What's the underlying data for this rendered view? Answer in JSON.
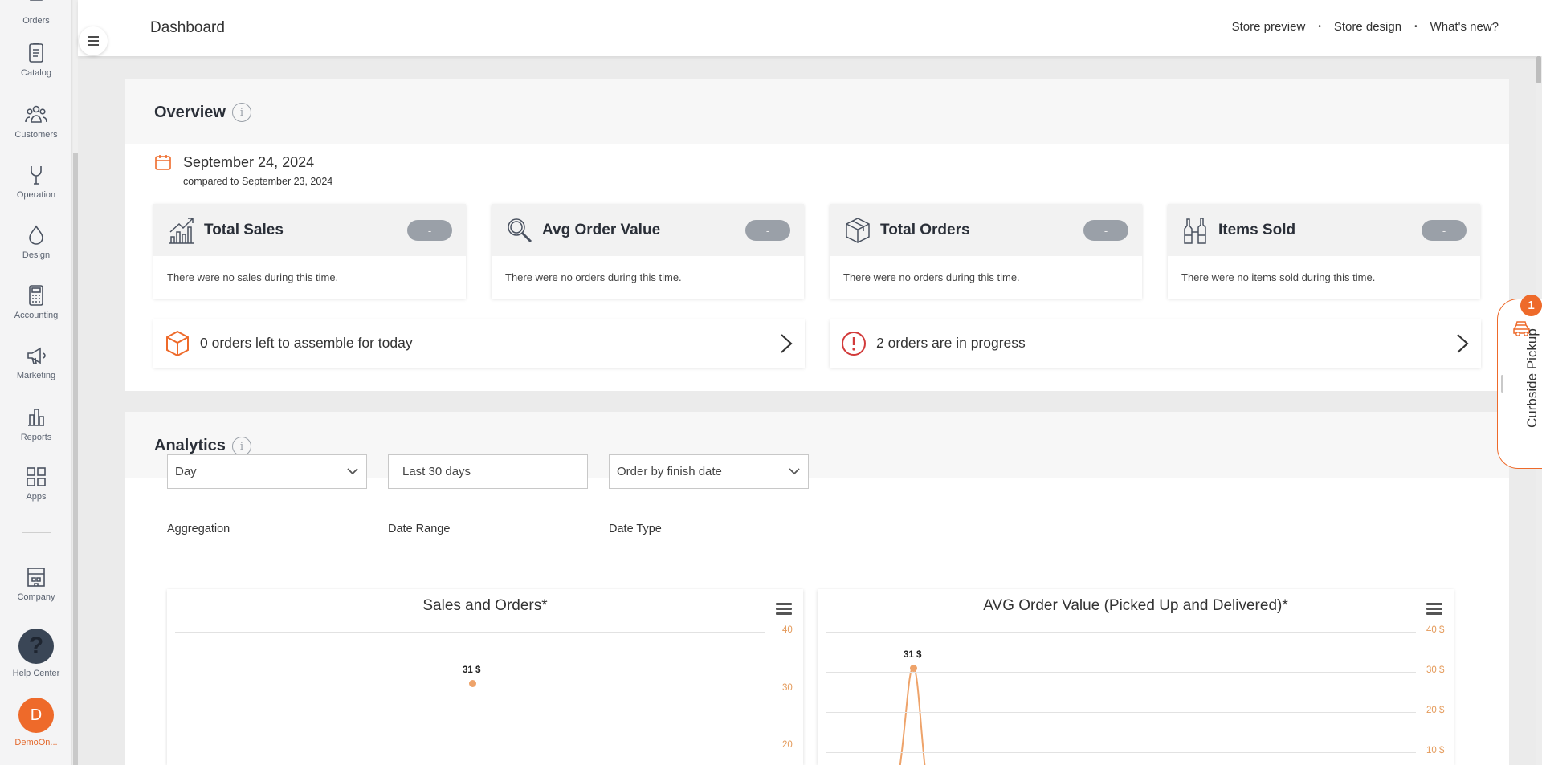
{
  "sidebar": {
    "items": [
      {
        "label": "Orders",
        "icon": "orders-icon"
      },
      {
        "label": "Catalog",
        "icon": "catalog-icon"
      },
      {
        "label": "Customers",
        "icon": "customers-icon"
      },
      {
        "label": "Operation",
        "icon": "operation-icon"
      },
      {
        "label": "Design",
        "icon": "design-icon"
      },
      {
        "label": "Accounting",
        "icon": "accounting-icon"
      },
      {
        "label": "Marketing",
        "icon": "marketing-icon"
      },
      {
        "label": "Reports",
        "icon": "reports-icon"
      },
      {
        "label": "Apps",
        "icon": "apps-icon"
      },
      {
        "label": "Company",
        "icon": "company-icon"
      },
      {
        "label": "Help Center",
        "icon": "help-icon"
      }
    ],
    "help_glyph": "?",
    "avatar_letter": "D",
    "org_name": "DemoOn..."
  },
  "header": {
    "title": "Dashboard",
    "links": [
      "Store preview",
      "Store design",
      "What's new?"
    ],
    "separator": "•"
  },
  "overview": {
    "title": "Overview",
    "info_glyph": "i",
    "date": "September 24, 2024",
    "compared": "compared to September 23, 2024",
    "kpis": [
      {
        "title": "Total Sales",
        "badge": "-",
        "text": "There were no sales during this time.",
        "icon": "bar-chart-icon"
      },
      {
        "title": "Avg Order Value",
        "badge": "-",
        "text": "There were no orders during this time.",
        "icon": "magnifier-icon"
      },
      {
        "title": "Total Orders",
        "badge": "-",
        "text": "There were no orders during this time.",
        "icon": "box-icon"
      },
      {
        "title": "Items Sold",
        "badge": "-",
        "text": "There were no items sold during this time.",
        "icon": "bottles-icon"
      }
    ],
    "strips": [
      {
        "text": "0 orders left to assemble for today",
        "icon": "package-icon"
      },
      {
        "text": "2 orders are in progress",
        "icon": "alert-icon"
      }
    ]
  },
  "analytics": {
    "title": "Analytics",
    "info_glyph": "i",
    "filters": [
      {
        "label": "Aggregation",
        "value": "Day",
        "dropdown": true
      },
      {
        "label": "Date Range",
        "value": "Last 30 days",
        "dropdown": false
      },
      {
        "label": "Date Type",
        "value": "Order by finish date",
        "dropdown": true
      }
    ]
  },
  "curbside": {
    "label": "Curbside Pickup",
    "badge": "1"
  },
  "colors": {
    "accent": "#ee6a2a",
    "chart_line": "#eea36a",
    "badge_gray": "#9aa0a8"
  },
  "chart_data": [
    {
      "type": "scatter",
      "title": "Sales and Orders*",
      "ylim": [
        20,
        40
      ],
      "y_ticks": [
        "40",
        "30",
        "20"
      ],
      "axis_position": "right",
      "points": [
        {
          "y": 31,
          "label": "31 $"
        }
      ]
    },
    {
      "type": "line",
      "title": "AVG Order Value (Picked Up and Delivered)*",
      "ylim": [
        10,
        40
      ],
      "y_ticks": [
        "40 $",
        "30 $",
        "20 $",
        "10 $"
      ],
      "axis_position": "right",
      "points": [
        {
          "y": 31,
          "label": "31 $"
        }
      ]
    }
  ]
}
